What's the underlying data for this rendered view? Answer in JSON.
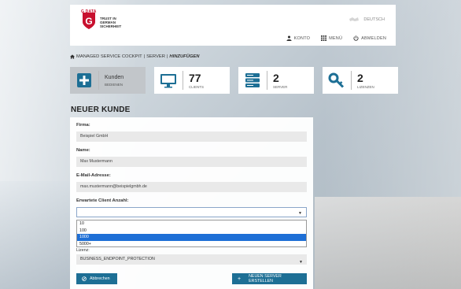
{
  "header": {
    "brand": "G DATA",
    "tagline": "TRUST IN GERMAN SICHERHEIT",
    "language": "DEUTSCH",
    "nav": {
      "account": "KONTO",
      "menu": "MENÜ",
      "logout": "ABMELDEN"
    }
  },
  "breadcrumb": {
    "items": [
      "MANAGED SERVICE COCKPIT",
      "SERVER"
    ],
    "current": "HINZUFÜGEN"
  },
  "tiles": {
    "customers": {
      "title": "Kunden",
      "sub": "BEDIENEN"
    },
    "clients": {
      "count": "77",
      "label": "CLIENTS"
    },
    "server": {
      "count": "2",
      "label": "SERVER"
    },
    "licenses": {
      "count": "2",
      "label": "LIZENZEN"
    }
  },
  "page_title": "NEUER KUNDE",
  "form": {
    "company_label": "Firma:",
    "company_value": "Beispiel GmbH",
    "name_label": "Name:",
    "name_value": "Max Mustermann",
    "email_label": "E-Mail-Adresse:",
    "email_value": "max.mustermann@beispielgmbh.de",
    "clients_label": "Erwartete Client Anzahl:",
    "clients_value": "",
    "clients_options": [
      "10",
      "100",
      "1000",
      "5000+"
    ],
    "clients_selected_index": 2,
    "license_label": "Lizenz:",
    "license_value": "BUSINESS_ENDPOINT_PROTECTION",
    "cancel_label": "Abbrechen",
    "create_label": "NEUEN SERVER ERSTELLEN"
  },
  "colors": {
    "primary": "#1d6f95",
    "brand_red": "#c8102e",
    "highlight": "#1e6fd6"
  }
}
